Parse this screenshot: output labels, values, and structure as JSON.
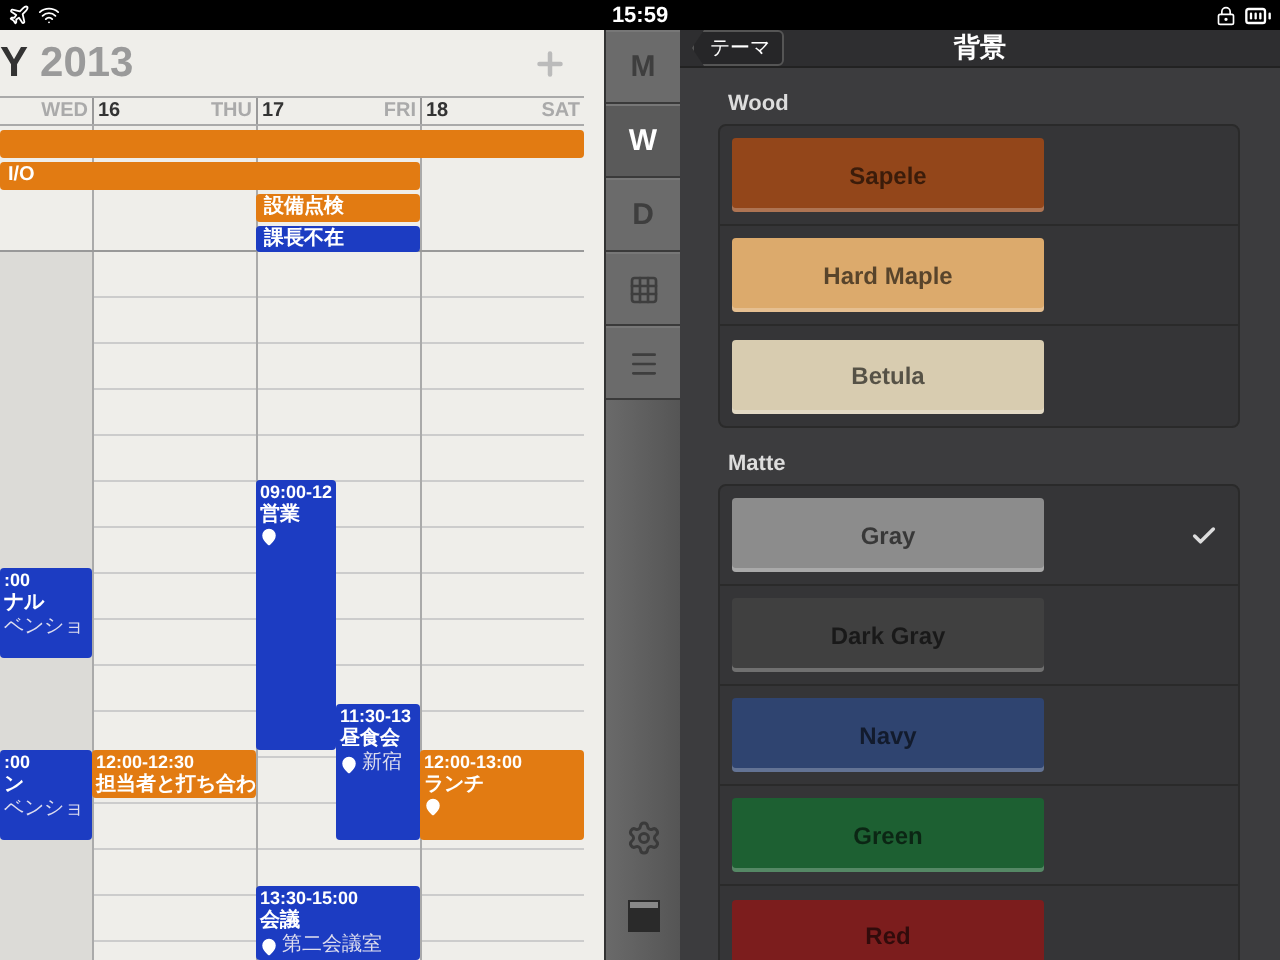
{
  "status_bar": {
    "time": "15:59"
  },
  "calendar": {
    "month": "Y",
    "year": "2013",
    "days": [
      {
        "weekday": "WED"
      },
      {
        "number": "16",
        "weekday": "THU"
      },
      {
        "number": "17",
        "weekday": "FRI"
      },
      {
        "number": "18",
        "weekday": "SAT"
      }
    ],
    "all_day_events": [
      {
        "color": "#e27b12"
      },
      {
        "title": "I/O",
        "color": "#e27b12"
      },
      {
        "title": "設備点検",
        "color": "#e27b12"
      },
      {
        "title": "課長不在",
        "color": "#1c3cc2"
      }
    ],
    "events": [
      {
        "time": "09:00-12",
        "title": "営業",
        "has_location": true,
        "color": "#1c3cc2"
      },
      {
        "time": ":00",
        "title": "ナル",
        "location": "ベンショ",
        "has_location": false,
        "color": "#1c3cc2"
      },
      {
        "time": "11:30-13",
        "title": "昼食会",
        "location": "新宿",
        "has_location": true,
        "color": "#1c3cc2"
      },
      {
        "time": ":00",
        "title": "ン",
        "location": "ベンショ",
        "has_location": false,
        "color": "#1c3cc2"
      },
      {
        "time": "12:00-12:30",
        "title": "担当者と打ち合わ",
        "has_location": false,
        "color": "#e27b12"
      },
      {
        "time": "12:00-13:00",
        "title": "ランチ",
        "has_location": true,
        "color": "#e27b12"
      },
      {
        "time": "13:30-15:00",
        "title": "会議",
        "location": "第二会議室",
        "has_location": true,
        "color": "#1c3cc2"
      }
    ]
  },
  "view_tabs": [
    {
      "kind": "text",
      "label": "M",
      "selected": false
    },
    {
      "kind": "text",
      "label": "W",
      "selected": true
    },
    {
      "kind": "text",
      "label": "D",
      "selected": false
    },
    {
      "kind": "grid",
      "selected": false
    },
    {
      "kind": "list",
      "selected": false
    }
  ],
  "settings": {
    "back": "テーマ",
    "title": "背景",
    "sections": [
      {
        "title": "Wood",
        "options": [
          {
            "name": "Sapele",
            "color": "#93461a",
            "selected": false
          },
          {
            "name": "Hard Maple",
            "color": "#dcaa6c",
            "selected": false
          },
          {
            "name": "Betula",
            "color": "#d8ccb0",
            "selected": false
          }
        ]
      },
      {
        "title": "Matte",
        "options": [
          {
            "name": "Gray",
            "color": "#8c8c8c",
            "selected": true
          },
          {
            "name": "Dark Gray",
            "color": "#404040",
            "selected": false
          },
          {
            "name": "Navy",
            "color": "#2f4470",
            "selected": false
          },
          {
            "name": "Green",
            "color": "#1d6032",
            "selected": false
          },
          {
            "name": "Red",
            "color": "#7c1d1d",
            "selected": false
          }
        ]
      }
    ]
  }
}
